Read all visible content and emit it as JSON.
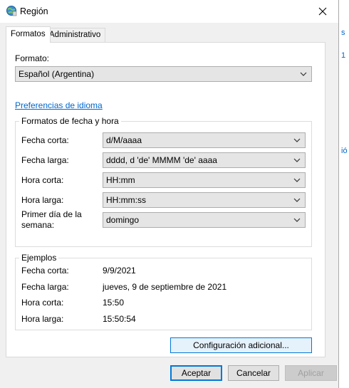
{
  "window": {
    "title": "Región"
  },
  "tabs": [
    {
      "label": "Formatos"
    },
    {
      "label": "Administrativo"
    }
  ],
  "formato": {
    "label": "Formato:",
    "value": "Español (Argentina)"
  },
  "language_link": "Preferencias de idioma",
  "formats_group": {
    "title": "Formatos de fecha y hora",
    "fields": [
      {
        "label": "Fecha corta:",
        "value": "d/M/aaaa"
      },
      {
        "label": "Fecha larga:",
        "value": "dddd, d 'de' MMMM 'de' aaaa"
      },
      {
        "label": "Hora corta:",
        "value": "HH:mm"
      },
      {
        "label": "Hora larga:",
        "value": "HH:mm:ss"
      },
      {
        "label_line1": "Primer día de la",
        "label_line2": "semana:",
        "value": "domingo"
      }
    ]
  },
  "examples_group": {
    "title": "Ejemplos",
    "rows": [
      {
        "label": "Fecha corta:",
        "value": "9/9/2021"
      },
      {
        "label": "Fecha larga:",
        "value": "jueves, 9 de septiembre de 2021"
      },
      {
        "label": "Hora corta:",
        "value": "15:50"
      },
      {
        "label": "Hora larga:",
        "value": "15:50:54"
      }
    ]
  },
  "buttons": {
    "additional": "Configuración adicional...",
    "ok": "Aceptar",
    "cancel": "Cancelar",
    "apply": "Aplicar"
  },
  "background_peek": [
    "s",
    "1",
    "ió"
  ]
}
